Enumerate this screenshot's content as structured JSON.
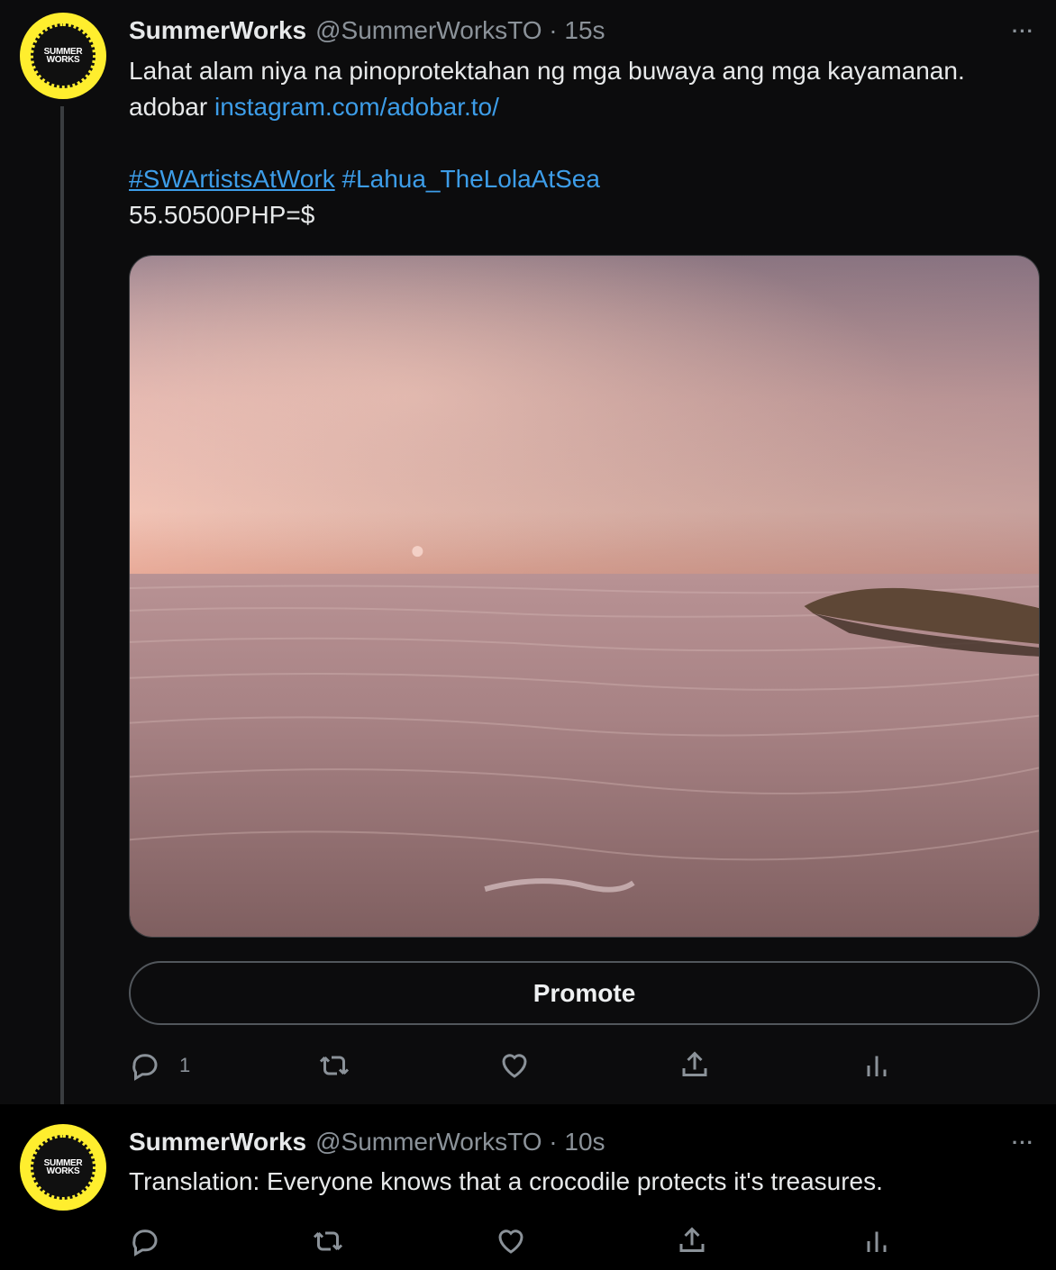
{
  "tweet1": {
    "avatar_text": "SUMMER\nWORKS",
    "name": "SummerWorks",
    "handle": "@SummerWorksTO · 15s",
    "more": "···",
    "line1": "Lahat alam niya na pinoprotektahan ng mga buwaya ang mga kayamanan.",
    "line2_prefix": "adobar ",
    "line2_link": "instagram.com/adobar.to/",
    "hashtag1": "#SWArtistsAtWork",
    "hashtag2": "#Lahua_TheLolaAtSea",
    "line4": "55.50500PHP=$",
    "promote_label": "Promote",
    "reply_count": "1"
  },
  "tweet2": {
    "avatar_text": "SUMMER\nWORKS",
    "name": "SummerWorks",
    "handle": "@SummerWorksTO · 10s",
    "more": "···",
    "text": "Translation: Everyone knows that a crocodile protects it's treasures."
  },
  "icons": {
    "reply": "comment-icon",
    "retweet": "retweet-icon",
    "like": "heart-icon",
    "share": "share-icon",
    "analytics": "analytics-icon"
  },
  "colors": {
    "link": "#3d9de8",
    "avatar_yellow": "#ffee2e",
    "muted": "#8b9299",
    "background": "#0c0c0d"
  }
}
